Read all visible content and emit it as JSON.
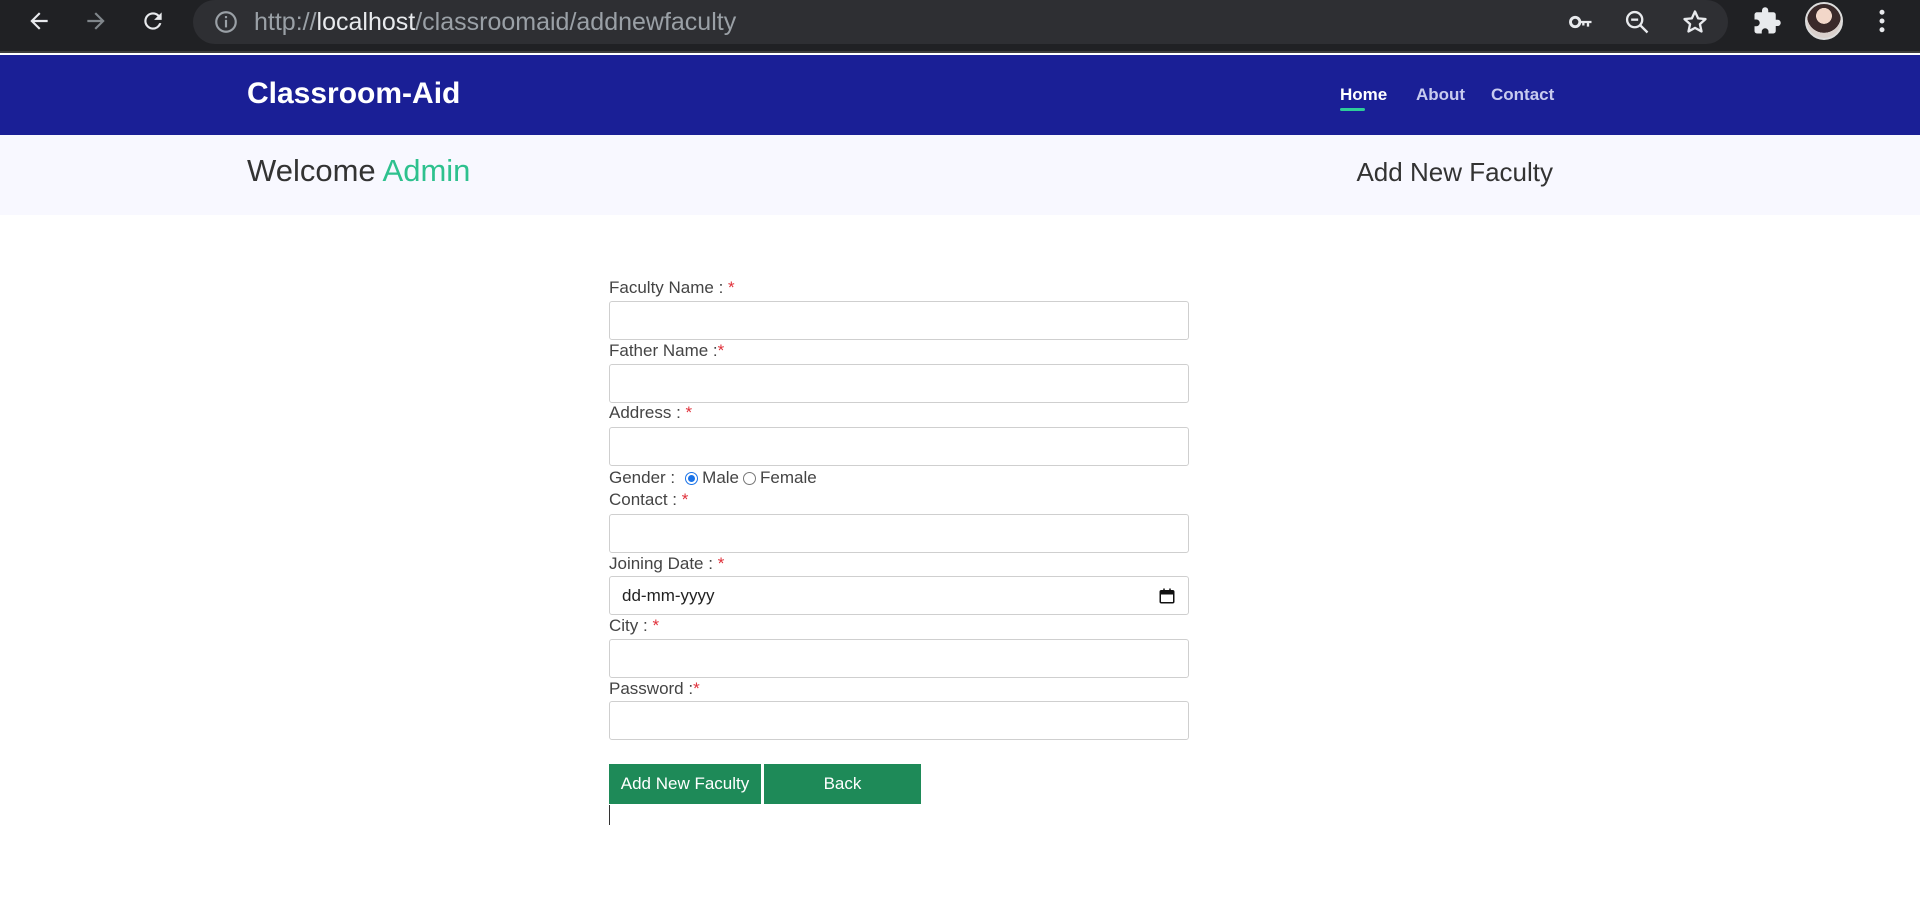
{
  "browser": {
    "url_scheme": "http://",
    "url_host": "localhost",
    "url_path": "/classroomaid/addnewfaculty",
    "icons": [
      "back-arrow-icon",
      "forward-arrow-icon",
      "reload-icon",
      "info-icon",
      "key-icon",
      "zoom-icon",
      "star-icon",
      "puzzle-icon",
      "menu-dots-icon"
    ]
  },
  "nav": {
    "brand": "Classroom-Aid",
    "items": [
      {
        "label": "Home",
        "active": true
      },
      {
        "label": "About",
        "active": false
      },
      {
        "label": "Contact",
        "active": false
      }
    ]
  },
  "header": {
    "welcome": "Welcome",
    "user": "Admin",
    "page_title": "Add New Faculty"
  },
  "form": {
    "faculty_name_label": "Faculty Name : ",
    "father_name_label": "Father Name :",
    "address_label": "Address : ",
    "gender_label": "Gender : ",
    "gender_options": [
      "Male",
      "Female"
    ],
    "gender_selected": "Male",
    "contact_label": "Contact : ",
    "joining_date_label": "Joining Date : ",
    "joining_date_placeholder": "dd-mm-yyyy",
    "city_label": "City : ",
    "password_label": "Password :",
    "required_mark": "*",
    "submit_label": "Add New Faculty",
    "back_label": "Back"
  },
  "colors": {
    "nav_bg": "#1a1f96",
    "accent": "#2ec18e",
    "button": "#1e8a58",
    "required": "#e0303a"
  }
}
